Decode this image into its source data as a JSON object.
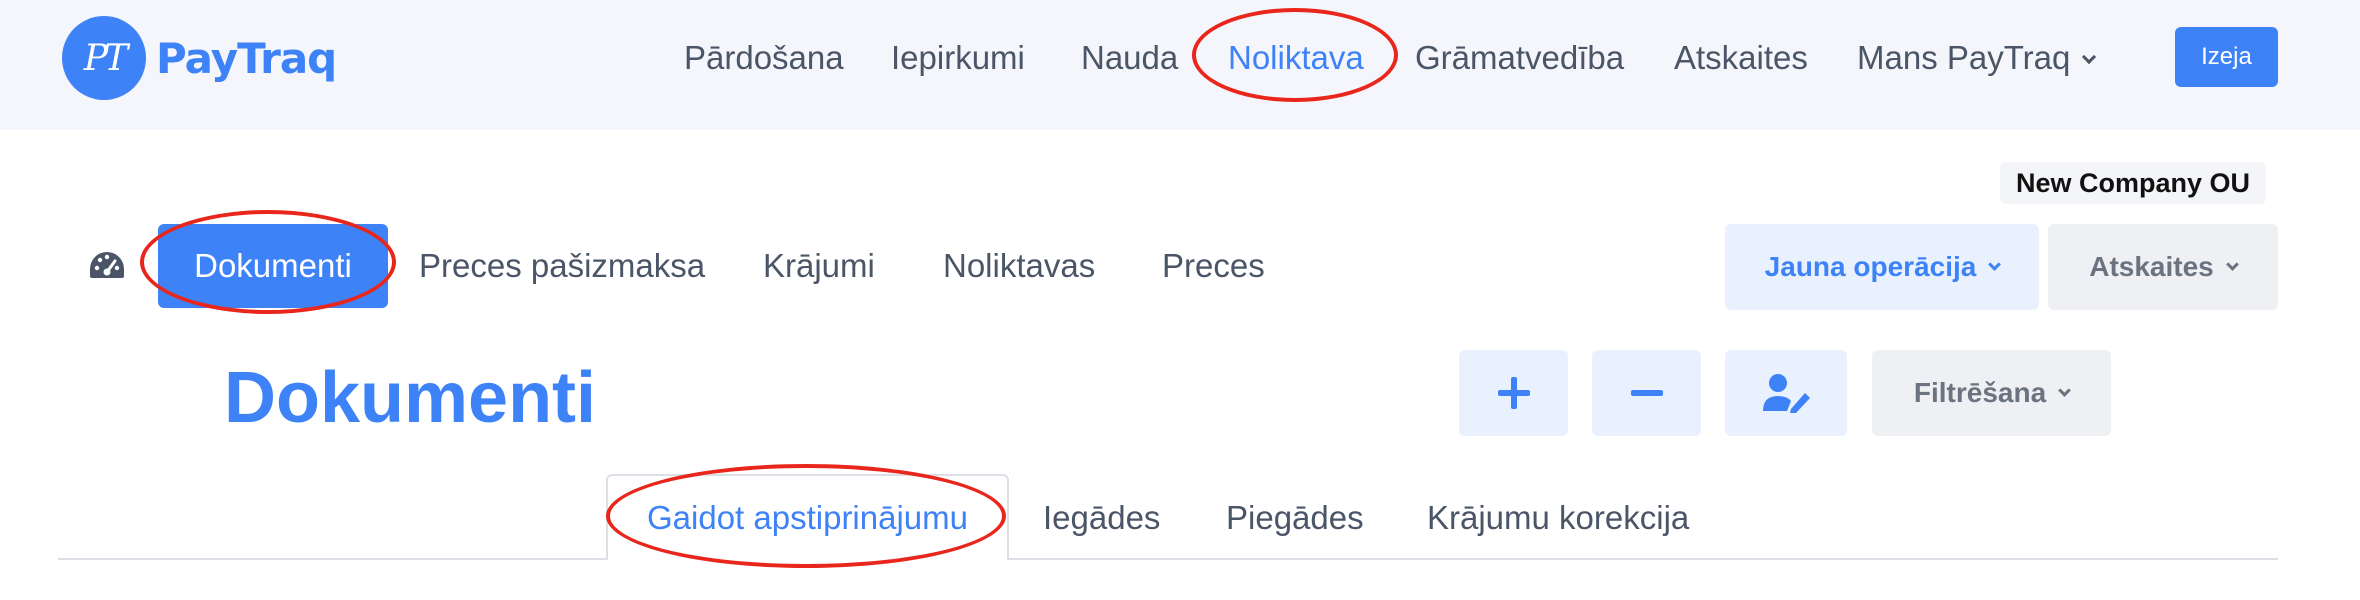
{
  "brand": {
    "logo_letters": "PT",
    "name": "PayTraq",
    "color": "#3e82f7"
  },
  "topnav": {
    "items": [
      {
        "label": "Pārdošana"
      },
      {
        "label": "Iepirkumi"
      },
      {
        "label": "Nauda"
      },
      {
        "label": "Noliktava",
        "active": true
      },
      {
        "label": "Grāmatvedība"
      },
      {
        "label": "Atskaites"
      },
      {
        "label": "Mans PayTraq",
        "dropdown": true
      }
    ],
    "exit_label": "Izeja"
  },
  "company": {
    "name": "New Company OU"
  },
  "subnav": {
    "icon": "speedometer-icon",
    "items": [
      {
        "label": "Dokumenti",
        "active": true
      },
      {
        "label": "Preces pašizmaksa"
      },
      {
        "label": "Krājumi"
      },
      {
        "label": "Noliktavas"
      },
      {
        "label": "Preces"
      }
    ],
    "new_operation_label": "Jauna operācija",
    "reports_label": "Atskaites"
  },
  "page": {
    "title": "Dokumenti",
    "actions": {
      "add_icon": "plus-icon",
      "remove_icon": "minus-icon",
      "assign_icon": "user-edit-icon"
    },
    "filter_label": "Filtrēšana"
  },
  "tabs": [
    {
      "label": "Gaidot apstiprinājumu",
      "active": true
    },
    {
      "label": "Iegādes"
    },
    {
      "label": "Piegādes"
    },
    {
      "label": "Krājumu korekcija"
    }
  ],
  "annotations": {
    "color": "#e8261c",
    "marked": [
      "Noliktava",
      "Dokumenti",
      "Gaidot apstiprinājumu"
    ]
  }
}
